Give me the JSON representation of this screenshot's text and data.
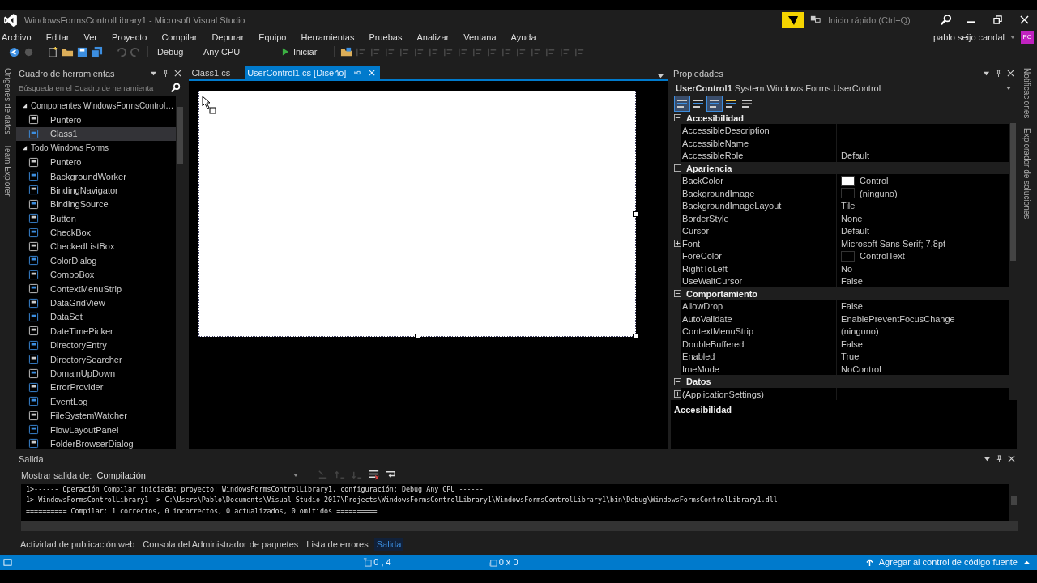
{
  "window": {
    "title": "WindowsFormsControlLibrary1 - Microsoft Visual Studio"
  },
  "quick_launch": {
    "placeholder": "Inicio rápido (Ctrl+Q)"
  },
  "user": {
    "name": "pablo seijo candal",
    "initials": "PC"
  },
  "menu": [
    "Archivo",
    "Editar",
    "Ver",
    "Proyecto",
    "Compilar",
    "Depurar",
    "Equipo",
    "Herramientas",
    "Pruebas",
    "Analizar",
    "Ventana",
    "Ayuda"
  ],
  "toolbar": {
    "configuration": "Debug",
    "platform": "Any CPU",
    "start": "Iniciar"
  },
  "left_tabs": [
    "Orígenes de datos",
    "Team Explorer"
  ],
  "right_tabs": [
    "Notificaciones",
    "Explorador de soluciones"
  ],
  "toolbox": {
    "title": "Cuadro de herramientas",
    "search": {
      "placeholder": "Búsqueda en el Cuadro de herramienta"
    },
    "groups": [
      {
        "label": "Componentes WindowsFormsControl…",
        "expanded": true,
        "items": [
          {
            "label": "Puntero",
            "selected": false
          },
          {
            "label": "Class1",
            "selected": true
          }
        ]
      },
      {
        "label": "Todo Windows Forms",
        "expanded": true,
        "items": [
          {
            "label": "Puntero",
            "selected": false
          },
          {
            "label": "BackgroundWorker",
            "selected": false
          },
          {
            "label": "BindingNavigator",
            "selected": false
          },
          {
            "label": "BindingSource",
            "selected": false
          },
          {
            "label": "Button",
            "selected": false
          },
          {
            "label": "CheckBox",
            "selected": false
          },
          {
            "label": "CheckedListBox",
            "selected": false
          },
          {
            "label": "ColorDialog",
            "selected": false
          },
          {
            "label": "ComboBox",
            "selected": false
          },
          {
            "label": "ContextMenuStrip",
            "selected": false
          },
          {
            "label": "DataGridView",
            "selected": false
          },
          {
            "label": "DataSet",
            "selected": false
          },
          {
            "label": "DateTimePicker",
            "selected": false
          },
          {
            "label": "DirectoryEntry",
            "selected": false
          },
          {
            "label": "DirectorySearcher",
            "selected": false
          },
          {
            "label": "DomainUpDown",
            "selected": false
          },
          {
            "label": "ErrorProvider",
            "selected": false
          },
          {
            "label": "EventLog",
            "selected": false
          },
          {
            "label": "FileSystemWatcher",
            "selected": false
          },
          {
            "label": "FlowLayoutPanel",
            "selected": false
          },
          {
            "label": "FolderBrowserDialog",
            "selected": false
          }
        ]
      }
    ]
  },
  "editor_tabs": [
    {
      "label": "Class1.cs",
      "selected": false
    },
    {
      "label": "UserControl1.cs [Diseño]",
      "selected": true
    }
  ],
  "properties": {
    "title": "Propiedades",
    "object": "UserControl1",
    "type": "System.Windows.Forms.UserControl",
    "view_buttons": [
      {
        "selected": true
      },
      {
        "selected": false
      },
      {
        "selected": true
      },
      {
        "selected": false
      },
      {
        "selected": false
      }
    ],
    "rows": [
      {
        "kind": "category",
        "label": "Accesibilidad",
        "expanded": true
      },
      {
        "kind": "property",
        "name": "AccessibleDescription"
      },
      {
        "kind": "property",
        "name": "AccessibleName"
      },
      {
        "kind": "property",
        "name": "AccessibleRole",
        "value": "Default"
      },
      {
        "kind": "category",
        "label": "Apariencia",
        "expanded": true
      },
      {
        "kind": "property",
        "name": "BackColor",
        "value": "Control",
        "color": "#ffffff"
      },
      {
        "kind": "property",
        "name": "BackgroundImage",
        "value": "(ninguno)",
        "color": "#000000"
      },
      {
        "kind": "property",
        "name": "BackgroundImageLayout",
        "value": "Tile"
      },
      {
        "kind": "property",
        "name": "BorderStyle",
        "value": "None"
      },
      {
        "kind": "property",
        "name": "Cursor",
        "value": "Default"
      },
      {
        "kind": "property",
        "name": "Font",
        "value": "Microsoft Sans Serif; 7,8pt",
        "expanded": false
      },
      {
        "kind": "property",
        "name": "ForeColor",
        "value": "ControlText",
        "color": "#000000"
      },
      {
        "kind": "property",
        "name": "RightToLeft",
        "value": "No"
      },
      {
        "kind": "property",
        "name": "UseWaitCursor",
        "value": "False"
      },
      {
        "kind": "category",
        "label": "Comportamiento",
        "expanded": true
      },
      {
        "kind": "property",
        "name": "AllowDrop",
        "value": "False"
      },
      {
        "kind": "property",
        "name": "AutoValidate",
        "value": "EnablePreventFocusChange"
      },
      {
        "kind": "property",
        "name": "ContextMenuStrip",
        "value": "(ninguno)"
      },
      {
        "kind": "property",
        "name": "DoubleBuffered",
        "value": "False"
      },
      {
        "kind": "property",
        "name": "Enabled",
        "value": "True"
      },
      {
        "kind": "property",
        "name": "ImeMode",
        "value": "NoControl"
      },
      {
        "kind": "category",
        "label": "Datos",
        "expanded": true
      },
      {
        "kind": "property",
        "name": "(ApplicationSettings)",
        "expanded": false
      }
    ]
  },
  "description": {
    "title": "Accesibilidad"
  },
  "output": {
    "title": "Salida",
    "source_label": "Mostrar salida de:",
    "source": "Compilación",
    "lines": [
      "1>------ Operación Compilar iniciada: proyecto: WindowsFormsControlLibrary1, configuración: Debug Any CPU ------",
      "1>  WindowsFormsControlLibrary1 -> C:\\Users\\Pablo\\Documents\\Visual Studio 2017\\Projects\\WindowsFormsControlLibrary1\\WindowsFormsControlLibrary1\\bin\\Debug\\WindowsFormsControlLibrary1.dll",
      "========== Compilar: 1 correctos, 0 incorrectos, 0 actualizados, 0 omitidos =========="
    ]
  },
  "bottom_tabs": [
    {
      "label": "Actividad de publicación web",
      "selected": false
    },
    {
      "label": "Consola del Administrador de paquetes",
      "selected": false
    },
    {
      "label": "Lista de errores",
      "selected": false
    },
    {
      "label": "Salida",
      "selected": true
    }
  ],
  "status_bar": {
    "position": "0 , 4",
    "size": "0 x 0",
    "source_control": "Agregar al control de código fuente"
  }
}
